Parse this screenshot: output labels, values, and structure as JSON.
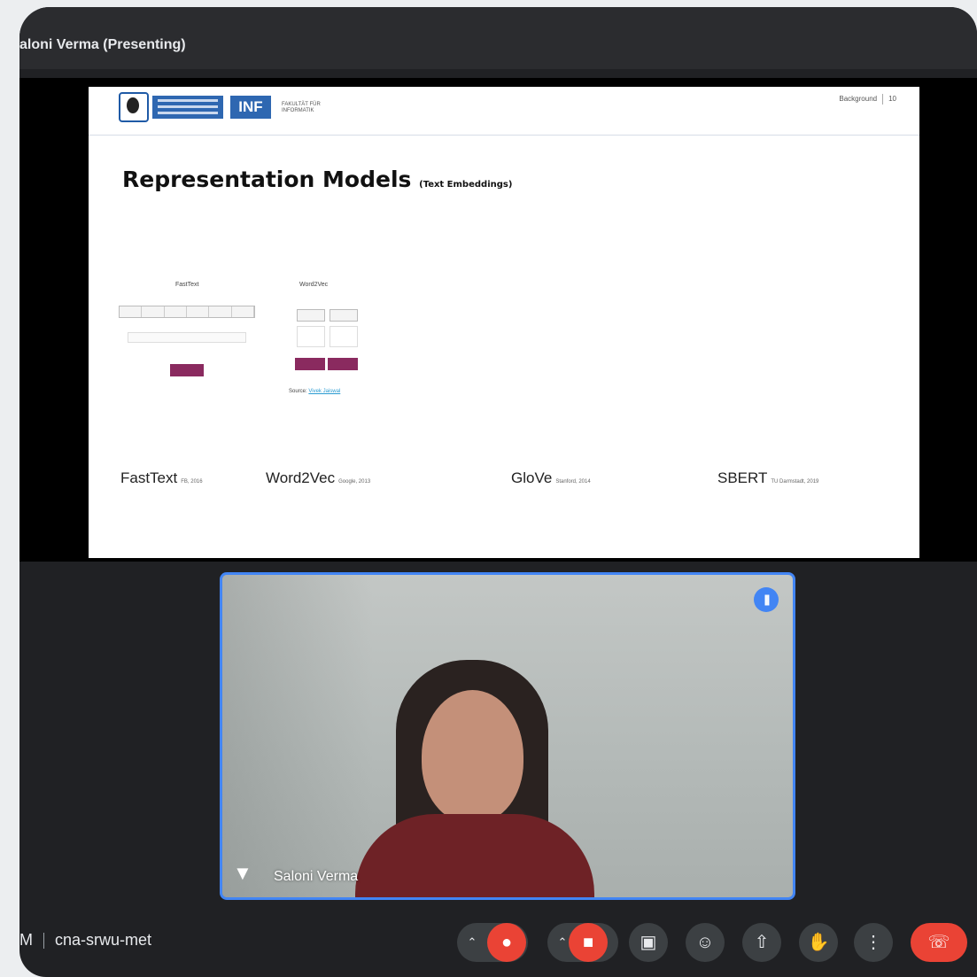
{
  "header": {
    "presenting_label": "aloni Verma (Presenting)"
  },
  "slide": {
    "faculty_text": "FAKULTÄT FÜR INFORMATIK",
    "inf_label": "INF",
    "section": "Background",
    "page_number": "10",
    "title": "Representation Models",
    "title_suffix": "(Text Embeddings)",
    "diagram_fasttext_label": "FastText",
    "diagram_word2vec_label": "Word2Vec",
    "source_label": "Source:",
    "source_link": "Vivek Jaiswal",
    "models": [
      {
        "name": "FastText",
        "note": "FB, 2016"
      },
      {
        "name": "Word2Vec",
        "note": "Google, 2013"
      },
      {
        "name": "GloVe",
        "note": "Stanford, 2014"
      },
      {
        "name": "SBERT",
        "note": "TU Darmstadt, 2019"
      }
    ]
  },
  "participant": {
    "name": "Saloni Verma"
  },
  "meeting": {
    "time_fragment": "M",
    "code": "cna-srwu-met"
  },
  "icons": [
    "speaking-indicator-icon",
    "pin-icon",
    "mic-off-icon",
    "camera-off-icon",
    "captions-icon",
    "emoji-icon",
    "present-icon",
    "raise-hand-icon",
    "more-options-icon",
    "end-call-icon"
  ],
  "colors": {
    "accent_blue": "#4285f4",
    "danger_red": "#ea4335",
    "surface": "#202124"
  }
}
